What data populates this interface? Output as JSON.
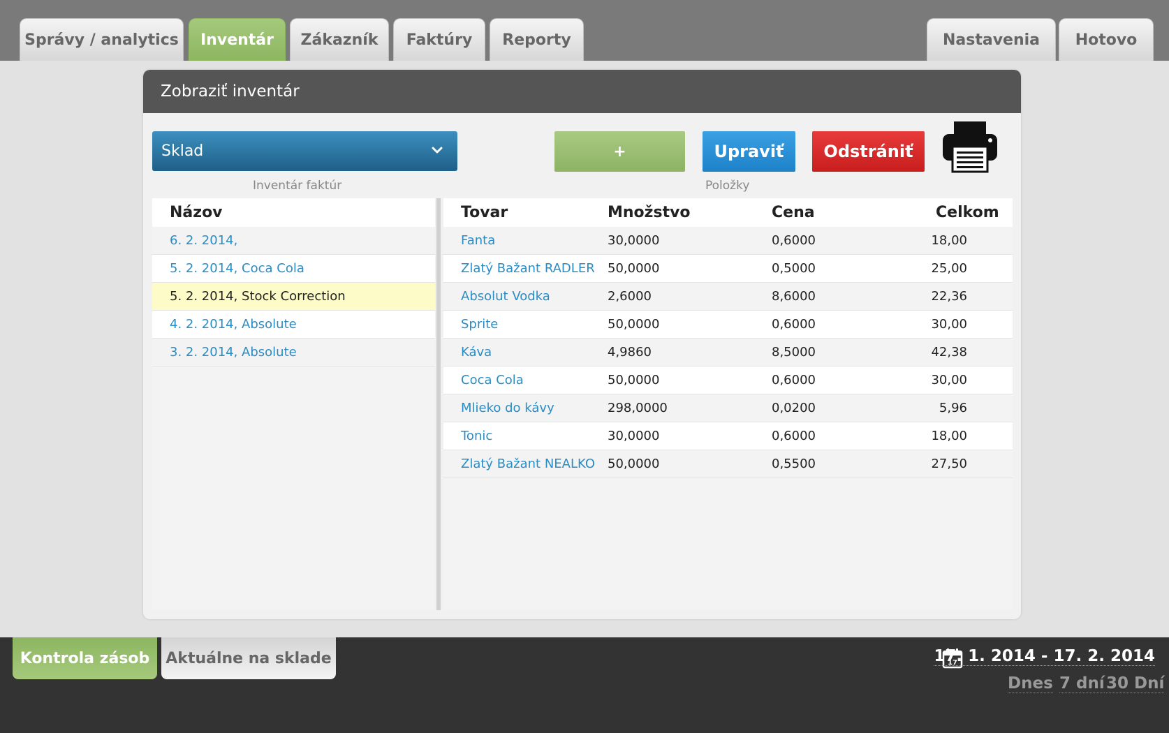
{
  "tabs": {
    "spravy": "Správy / analytics",
    "inventar": "Inventár",
    "zakaznik": "Zákazník",
    "faktury": "Faktúry",
    "reporty": "Reporty",
    "nastavenia": "Nastavenia",
    "hotovo": "Hotovo"
  },
  "panel": {
    "title": "Zobraziť inventár",
    "select_value": "Sklad",
    "left_caption": "Inventár faktúr",
    "right_caption": "Položky",
    "add_label": "+",
    "edit_label": "Upraviť",
    "delete_label": "Odstrániť"
  },
  "invoices": {
    "header": "Názov",
    "rows": [
      "6. 2. 2014,",
      "5. 2. 2014, Coca Cola",
      "5. 2. 2014, Stock Correction",
      "4. 2. 2014, Absolute",
      "3. 2. 2014, Absolute"
    ],
    "selected_index": 2
  },
  "items": {
    "headers": [
      "Tovar",
      "Množstvo",
      "Cena",
      "Celkom"
    ],
    "rows": [
      [
        "Fanta",
        "30,0000",
        "0,6000",
        "18,00"
      ],
      [
        "Zlatý Bažant RADLER",
        "50,0000",
        "0,5000",
        "25,00"
      ],
      [
        "Absolut Vodka",
        "2,6000",
        "8,6000",
        "22,36"
      ],
      [
        "Sprite",
        "50,0000",
        "0,6000",
        "30,00"
      ],
      [
        "Káva",
        "4,9860",
        "8,5000",
        "42,38"
      ],
      [
        "Coca Cola",
        "50,0000",
        "0,6000",
        "30,00"
      ],
      [
        "Mlieko do kávy",
        "298,0000",
        "0,0200",
        "5,96"
      ],
      [
        "Tonic",
        "30,0000",
        "0,6000",
        "18,00"
      ],
      [
        "Zlatý Bažant NEALKO",
        "50,0000",
        "0,5500",
        "27,50"
      ]
    ]
  },
  "bottom": {
    "tab_active": "Kontrola zásob",
    "tab_inactive": "Aktuálne na sklade",
    "date_range": "17. 1. 2014 - 17. 2. 2014",
    "calendar_day": "17",
    "quick_today": "Dnes",
    "quick_7": "7 dní",
    "quick_30": "30 Dní"
  },
  "colors": {
    "active_green": "#8cb660",
    "link_blue": "#2a8cc4",
    "edit_blue": "#1d82c9",
    "delete_red": "#c81e1e",
    "selected_row": "#fdfcc8"
  },
  "icons": [
    "chevron-down-icon",
    "printer-icon",
    "calendar-icon"
  ]
}
